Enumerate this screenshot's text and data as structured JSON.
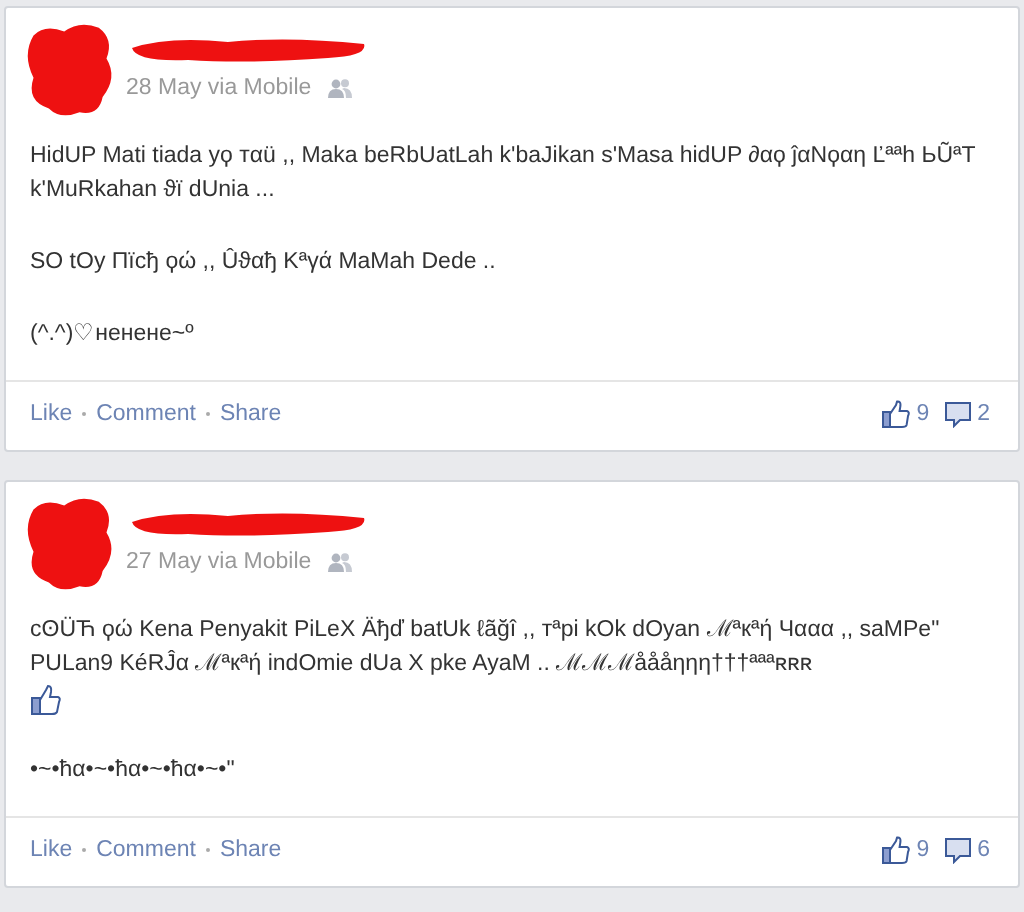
{
  "posts": [
    {
      "date": "28 May via Mobile",
      "paragraphs": [
        {
          "kind": "text",
          "text": "HidUP Mati tiada уϙ тαü ,, Maka beRbUatLah k'baJikan s'Masa hidUP ∂αϙ ĵαΝϙαη Ľªªh ЬŨªΤ k'MuRkahan ϑï dUnia ..."
        },
        {
          "kind": "text",
          "text": "SO tOy Пïcђ ϙώ ,, Ûϑαђ Kªγά MaMah Dede .."
        },
        {
          "kind": "text",
          "text": "(^.^)♡ненене~º"
        }
      ],
      "actions": [
        "Like",
        "Comment",
        "Share"
      ],
      "likes": "9",
      "comments": "2"
    },
    {
      "date": "27 May via Mobile",
      "paragraphs": [
        {
          "kind": "text",
          "text": "cʘÜЋ ϙώ Kena Penyakit PiLeX Äђď batUk ℓãğî ,, тªpi kOk dOyan ℳªкªή Чααα ,, saMPe\" PULan9 KéRĴα ℳªкªή indOmie dUa X pke AyaM .. ℳℳℳåååηηη†††ªªªʀʀʀ"
        },
        {
          "kind": "emoticon"
        },
        {
          "kind": "text",
          "text": "•~•ћα•~•ћα•~•ћα•~•\""
        }
      ],
      "actions": [
        "Like",
        "Comment",
        "Share"
      ],
      "likes": "9",
      "comments": "6"
    }
  ]
}
